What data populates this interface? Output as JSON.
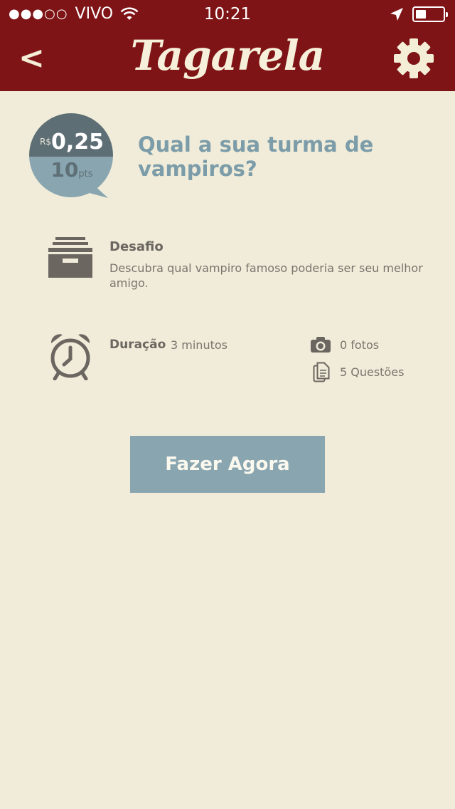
{
  "status_bar": {
    "signal_dots": "●●●○○",
    "carrier": "VIVO",
    "time": "10:21"
  },
  "nav": {
    "back_label": "<",
    "app_title": "Tagarela"
  },
  "reward": {
    "currency": "R$",
    "amount": "0,25",
    "points": "10",
    "points_unit": "pts"
  },
  "survey": {
    "question": "Qual a sua turma de vampiros?"
  },
  "challenge": {
    "title": "Desafio",
    "description": "Descubra qual vampiro famoso poderia ser seu melhor amigo."
  },
  "details": {
    "duration_label": "Duração",
    "duration_value": "3 minutos",
    "photos": "0 fotos",
    "questions": "5 Questões"
  },
  "cta": {
    "label": "Fazer Agora"
  },
  "colors": {
    "header": "#7f1416",
    "background": "#f0ecd9",
    "accent": "#88a5b0",
    "icon": "#6b6660"
  },
  "icons": [
    "wifi-icon",
    "location-arrow-icon",
    "battery-icon",
    "gear-icon",
    "archive-drawer-icon",
    "alarm-clock-icon",
    "camera-icon",
    "documents-icon"
  ]
}
